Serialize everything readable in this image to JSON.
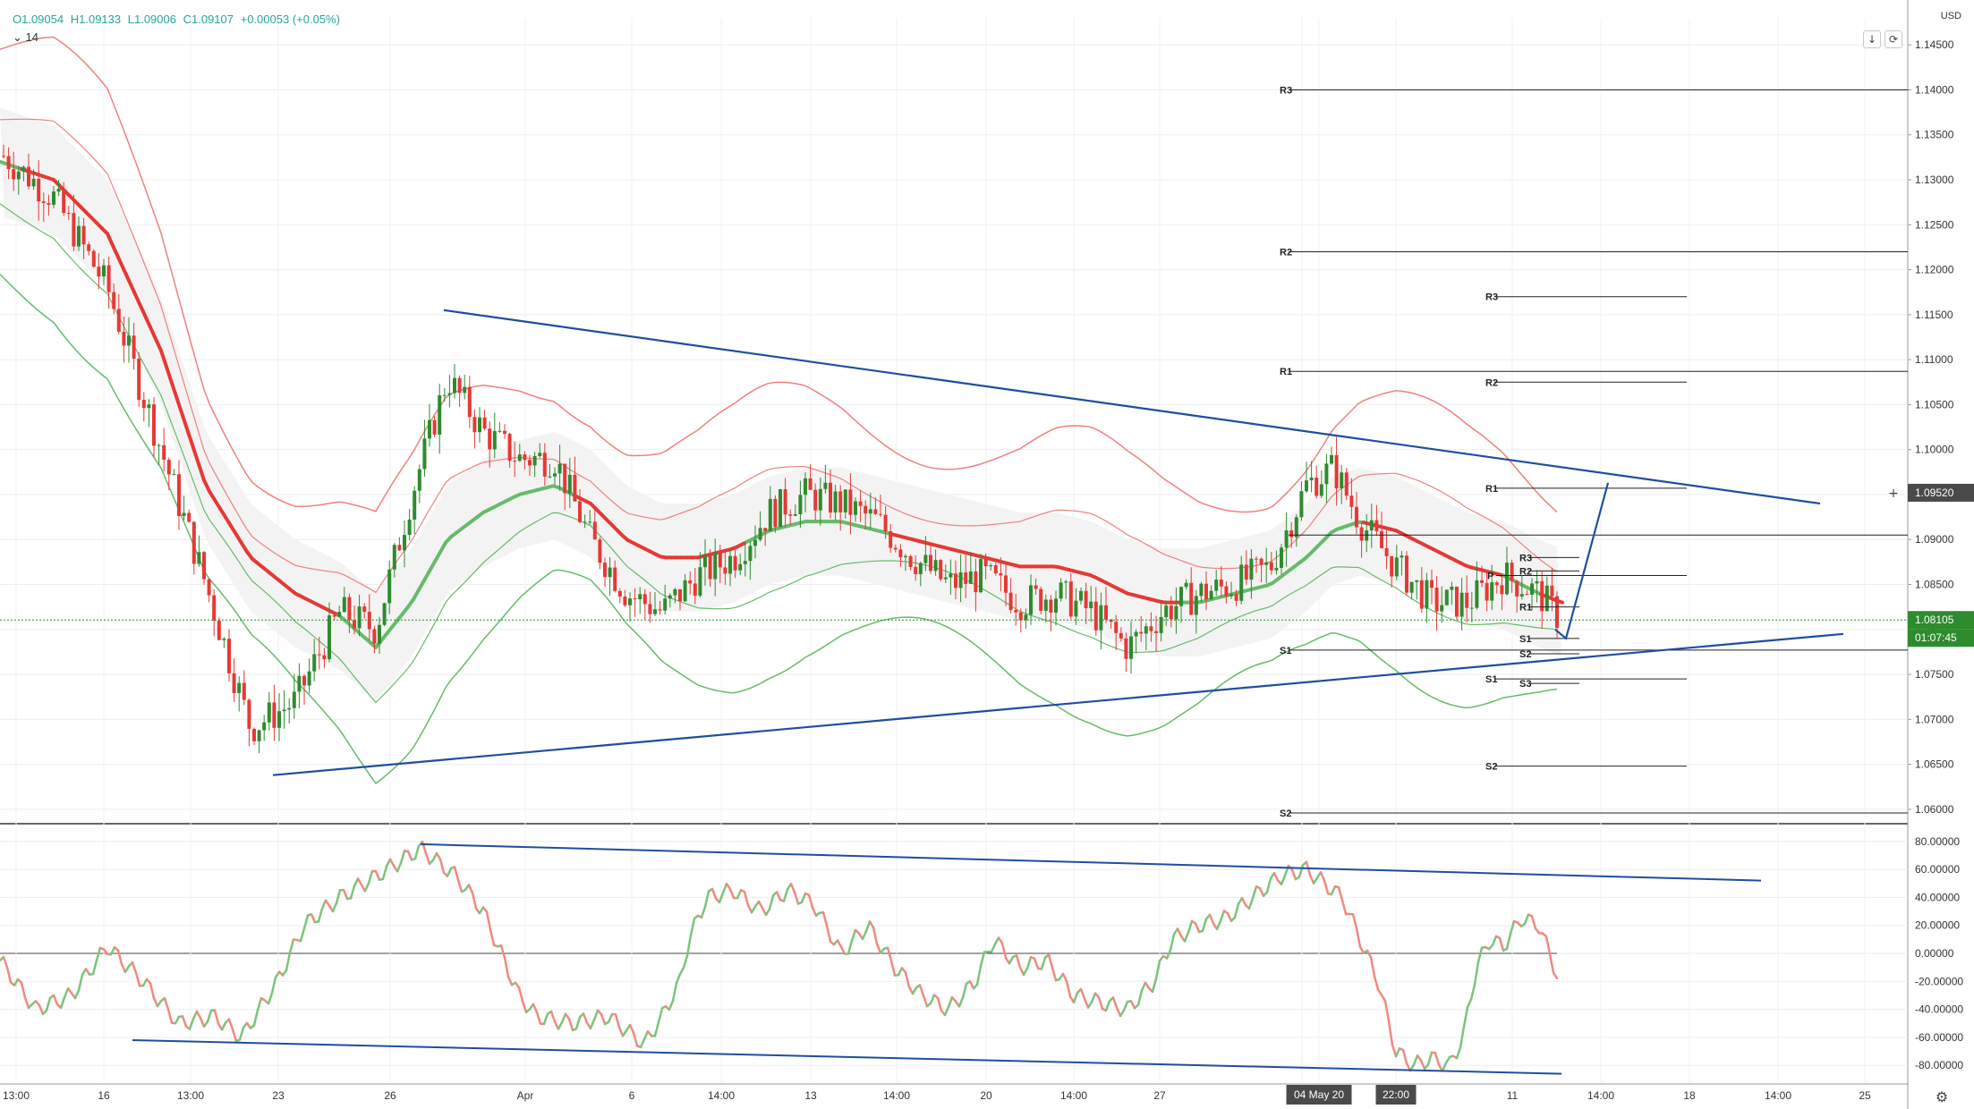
{
  "header": {
    "open": "O1.09054",
    "high": "H1.09133",
    "low": "L1.09006",
    "close": "C1.09107",
    "change": "+0.00053 (+0.05%)",
    "indicator_label": "14",
    "currency": "USD"
  },
  "colors": {
    "up": "#26a69a",
    "candle_up": "#2e8b2e",
    "candle_down": "#e53935",
    "band_red": "#f08080",
    "band_green": "#66bb6a",
    "trend": "#1f4e9e",
    "rsi_up": "#7cc47c",
    "rsi_down": "#f08a80"
  },
  "chart_data": [
    {
      "type": "candlestick",
      "name": "price",
      "y_axis": {
        "unit": "USD",
        "ticks": [
          "1.14500",
          "1.14000",
          "1.13500",
          "1.13000",
          "1.12500",
          "1.12000",
          "1.11500",
          "1.11000",
          "1.10500",
          "1.10000",
          "1.09500",
          "1.09000",
          "1.08500",
          "1.08000",
          "1.07500",
          "1.07000",
          "1.06500",
          "1.06000"
        ],
        "range": [
          1.0585,
          1.148
        ]
      },
      "x_axis": {
        "ticks": [
          "13:00",
          "16",
          "13:00",
          "23",
          "26",
          "Apr",
          "6",
          "14:00",
          "13",
          "14:00",
          "20",
          "14:00",
          "27",
          "May",
          "04 May 20",
          "22:00",
          "11",
          "14:00",
          "18",
          "14:00",
          "25"
        ]
      },
      "current_price": "1.08105",
      "countdown": "01:07:45",
      "crosshair_price": "1.09520",
      "pivot_levels": [
        {
          "label": "R3",
          "price": 1.14
        },
        {
          "label": "R2",
          "price": 1.122
        },
        {
          "label": "R1",
          "price": 1.1087
        },
        {
          "label": "S1",
          "price": 1.0777
        },
        {
          "label": "S2",
          "price": 1.0596
        },
        {
          "label": "R3",
          "price": 1.117
        },
        {
          "label": "R2",
          "price": 1.1075
        },
        {
          "label": "R1",
          "price": 1.0957
        },
        {
          "label": "S1",
          "price": 1.0745
        },
        {
          "label": "S2",
          "price": 1.0648
        },
        {
          "label": "R3",
          "price": 1.088
        },
        {
          "label": "R2",
          "price": 1.0865
        },
        {
          "label": "R1",
          "price": 1.0825
        },
        {
          "label": "S1",
          "price": 1.079
        },
        {
          "label": "S2",
          "price": 1.0773
        },
        {
          "label": "S3",
          "price": 1.074
        },
        {
          "label": "P",
          "price": 1.086
        }
      ],
      "trendlines": [
        {
          "from": [
            1.1155
          ],
          "to": [
            1.094
          ]
        },
        {
          "from": [
            1.0638
          ],
          "to": [
            1.0795
          ]
        }
      ],
      "projection": {
        "points": [
          1.08,
          1.079,
          1.0963
        ]
      }
    },
    {
      "type": "line",
      "name": "oscillator",
      "y_axis": {
        "ticks": [
          "80.00000",
          "60.00000",
          "40.00000",
          "20.00000",
          "0.00000",
          "-20.00000",
          "-40.00000",
          "-60.00000",
          "-80.00000"
        ],
        "range": [
          -92,
          92
        ]
      },
      "trendlines": [
        {
          "from": [
            78
          ],
          "to": [
            52
          ]
        },
        {
          "from": [
            -62
          ],
          "to": [
            -86
          ]
        }
      ]
    }
  ]
}
